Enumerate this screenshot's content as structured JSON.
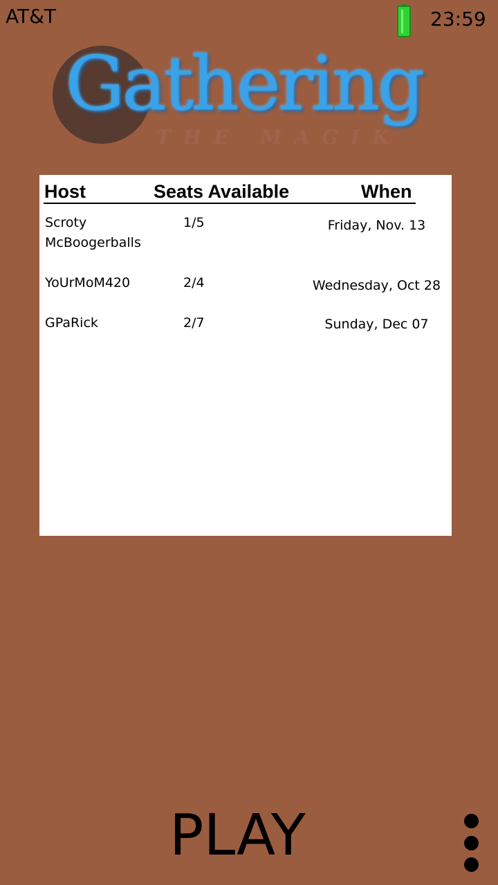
{
  "status_bar": {
    "carrier": "AT&T",
    "time": "23:59",
    "battery_icon": "battery-full-icon",
    "battery_color": "#22cc22"
  },
  "logo": {
    "title": "Gathering",
    "subtitle": "THE MAGIK"
  },
  "table": {
    "headers": {
      "host": "Host",
      "seats": "Seats Available",
      "when": "When"
    },
    "rows": [
      {
        "host": "Scroty McBoogerballs",
        "seats": "1/5",
        "when": "Friday, Nov. 13"
      },
      {
        "host": "YoUrMoM420",
        "seats": "2/4",
        "when": "Wednesday, Oct 28"
      },
      {
        "host": "GPaRick",
        "seats": "2/7",
        "when": "Sunday, Dec 07"
      }
    ]
  },
  "actions": {
    "play_label": "PLAY",
    "menu_icon": "more-vertical-icon"
  },
  "colors": {
    "background": "#9b5d40",
    "panel": "#ffffff",
    "logo_blue": "#39a2e8",
    "logo_circle": "#573a30"
  }
}
